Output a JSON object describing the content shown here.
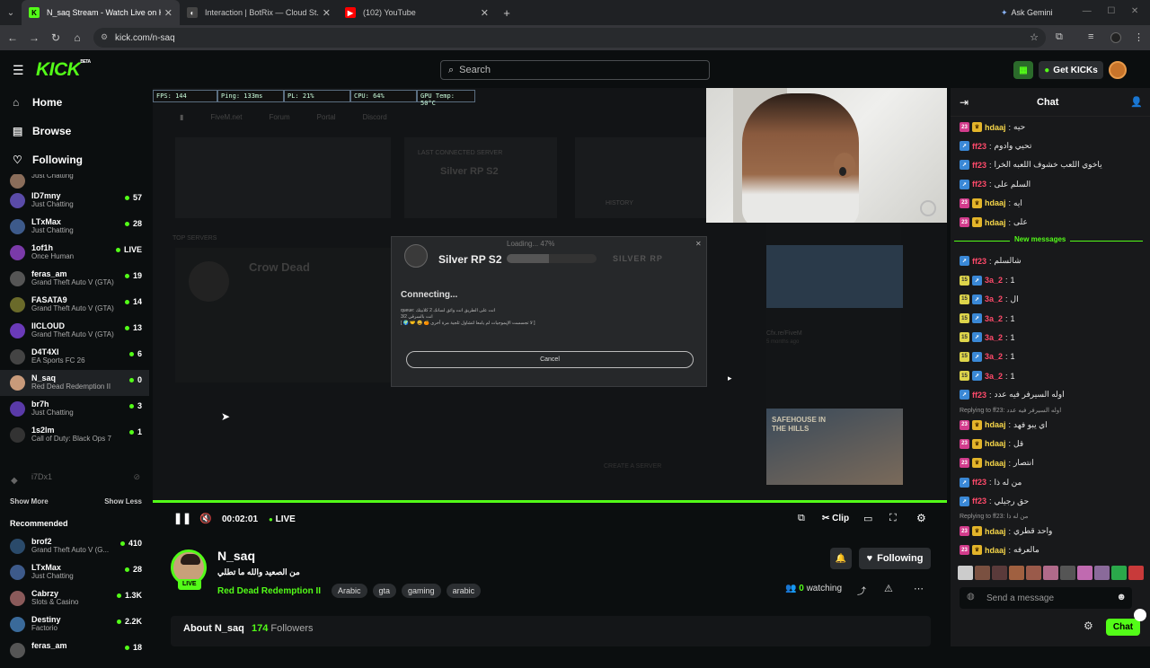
{
  "browser": {
    "tabs": [
      {
        "title": "N_saq Stream - Watch Live on Kick",
        "favicon": "K",
        "favicon_color": "#53fc18"
      },
      {
        "title": "Interaction | BotRix — Cloud St...",
        "favicon": "◐",
        "favicon_color": "#444"
      },
      {
        "title": "(102) YouTube",
        "favicon": "▶",
        "favicon_color": "#ff0000"
      }
    ],
    "new_tab": "+",
    "ask_gemini": "Ask Gemini",
    "url": "kick.com/n-saq"
  },
  "header": {
    "logo": "KICK",
    "logo_sup": "BETA",
    "search_placeholder": "Search",
    "get_kicks": "Get KICKs"
  },
  "sidebar": {
    "nav": [
      {
        "label": "Home",
        "icon": "home-icon"
      },
      {
        "label": "Browse",
        "icon": "browse-icon"
      },
      {
        "label": "Following",
        "icon": "heart-icon"
      }
    ],
    "following": [
      {
        "name": "",
        "category": "Just Chatting",
        "viewers": "",
        "color": "#8a6d5a"
      },
      {
        "name": "ID7mny",
        "category": "Just Chatting",
        "viewers": "57",
        "color": "#5a4ba8"
      },
      {
        "name": "LTxMax",
        "category": "Just Chatting",
        "viewers": "28",
        "color": "#3d5a8a"
      },
      {
        "name": "1of1h",
        "category": "Once Human",
        "viewers": "LIVE",
        "color": "#7a3aa8"
      },
      {
        "name": "feras_am",
        "category": "Grand Theft Auto V (GTA)",
        "viewers": "19",
        "color": "#555"
      },
      {
        "name": "FASATA9",
        "category": "Grand Theft Auto V (GTA)",
        "viewers": "14",
        "color": "#6a6a2a"
      },
      {
        "name": "IICLOUD",
        "category": "Grand Theft Auto V (GTA)",
        "viewers": "13",
        "color": "#6a3ab8"
      },
      {
        "name": "D4T4XI",
        "category": "EA Sports FC 26",
        "viewers": "6",
        "color": "#444"
      },
      {
        "name": "N_saq",
        "category": "Red Dead Redemption II",
        "viewers": "0",
        "color": "#c89a7a"
      },
      {
        "name": "br7h",
        "category": "Just Chatting",
        "viewers": "3",
        "color": "#5a3aa8"
      },
      {
        "name": "1s2lm",
        "category": "Call of Duty: Black Ops 7",
        "viewers": "1",
        "color": "#333"
      }
    ],
    "offline_user": "i7Dx1",
    "show_more": "Show More",
    "show_less": "Show Less",
    "recommended_title": "Recommended",
    "recommended": [
      {
        "name": "brof2",
        "category": "Grand Theft Auto V (G...",
        "viewers": "410",
        "color": "#2a4a6a"
      },
      {
        "name": "LTxMax",
        "category": "Just Chatting",
        "viewers": "28",
        "color": "#3d5a8a"
      },
      {
        "name": "Cabrzy",
        "category": "Slots & Casino",
        "viewers": "1.3K",
        "color": "#8a5a5a"
      },
      {
        "name": "Destiny",
        "category": "Factorio",
        "viewers": "2.2K",
        "color": "#3a6a9a"
      },
      {
        "name": "feras_am",
        "category": "",
        "viewers": "18",
        "color": "#555"
      }
    ]
  },
  "stream_overlay": {
    "stats": [
      "FPS: 144",
      "Ping: 133ms",
      "PL: 21%",
      "CPU: 64%",
      "GPU Temp: 50°C"
    ],
    "fivem_tabs": [
      "FiveM.net",
      "Forum",
      "Portal",
      "Discord"
    ],
    "last_connected": "LAST CONNECTED SERVER",
    "server_name": "Silver RP S2",
    "history": "HISTORY",
    "top_servers": "TOP SERVERS",
    "crow_dead": "Crow Dead",
    "create_server": "CREATE A SERVER",
    "dialog": {
      "server": "Silver RP S2",
      "loading": "Loading... 47%",
      "brand": "SILVER RP",
      "connecting": "Connecting...",
      "queue_label": "queue:",
      "queue_text": "انت على الطريق انت واثق لسانك 2 كلابيتك",
      "queue_count": "3/2",
      "queue_line3": "انت بالسرقي",
      "queue_emoji_line": "[ 🌍 🤝 😀 🍊 لا تجسست الإيموجيات لم يامعا لتشاول ثلجية مرة أخرى ]",
      "cancel": "Cancel"
    },
    "news_title": "Cfx.re/FiveM",
    "news_time": "5 months ago",
    "news_banner": "SAFEHOUSE IN THE HILLS"
  },
  "player": {
    "time": "00:02:01",
    "live": "LIVE",
    "clip": "Clip"
  },
  "channel": {
    "name": "N_saq",
    "title": "من الصعيد والله ما تطلي",
    "live_badge": "LIVE",
    "category": "Red Dead Redemption II",
    "tags": [
      "Arabic",
      "gta",
      "gaming",
      "arabic"
    ],
    "watching_count": "0",
    "watching_label": "watching",
    "following_label": "Following",
    "about": "About N_saq",
    "followers_count": "174",
    "followers_label": "Followers"
  },
  "chat": {
    "title": "Chat",
    "new_messages": "New messages",
    "messages_before": [
      {
        "badges": [
          "23",
          "crown"
        ],
        "user": "hdaaj",
        "color": "#f6d64a",
        "text": "حيه"
      },
      {
        "badges": [
          "arrow"
        ],
        "user": "ff23",
        "color": "#ff4a6a",
        "text": "تحيي وادوم"
      },
      {
        "badges": [
          "arrow"
        ],
        "user": "ff23",
        "color": "#ff4a6a",
        "text": "ياخوي اللعب خشوف اللعبه الخرا"
      },
      {
        "badges": [
          "arrow"
        ],
        "user": "ff23",
        "color": "#ff4a6a",
        "text": "السلم على"
      },
      {
        "badges": [
          "23",
          "crown"
        ],
        "user": "hdaaj",
        "color": "#f6d64a",
        "text": "ايه"
      },
      {
        "badges": [
          "23",
          "crown"
        ],
        "user": "hdaaj",
        "color": "#f6d64a",
        "text": "على"
      }
    ],
    "messages_after": [
      {
        "badges": [
          "arrow"
        ],
        "user": "ff23",
        "color": "#ff4a6a",
        "text": "شالسلم",
        "reply": ""
      },
      {
        "badges": [
          "15",
          "arrow"
        ],
        "user": "3a_2",
        "color": "#ff4a6a",
        "text": "1",
        "reply": ""
      },
      {
        "badges": [
          "15",
          "arrow"
        ],
        "user": "3a_2",
        "color": "#ff4a6a",
        "text": "ال",
        "reply": ""
      },
      {
        "badges": [
          "15",
          "arrow"
        ],
        "user": "3a_2",
        "color": "#ff4a6a",
        "text": "1",
        "reply": ""
      },
      {
        "badges": [
          "15",
          "arrow"
        ],
        "user": "3a_2",
        "color": "#ff4a6a",
        "text": "1",
        "reply": ""
      },
      {
        "badges": [
          "15",
          "arrow"
        ],
        "user": "3a_2",
        "color": "#ff4a6a",
        "text": "1",
        "reply": ""
      },
      {
        "badges": [
          "15",
          "arrow"
        ],
        "user": "3a_2",
        "color": "#ff4a6a",
        "text": "1",
        "reply": ""
      },
      {
        "badges": [
          "arrow"
        ],
        "user": "ff23",
        "color": "#ff4a6a",
        "text": "اوله السيرفر فيه عدد",
        "reply": ""
      },
      {
        "badges": [
          "23",
          "crown"
        ],
        "user": "hdaaj",
        "color": "#f6d64a",
        "text": "اي يبو فهد",
        "reply": "Replying to ff23: اوله السيرفر فيه عدد"
      },
      {
        "badges": [
          "23",
          "crown"
        ],
        "user": "hdaaj",
        "color": "#f6d64a",
        "text": "قل",
        "reply": ""
      },
      {
        "badges": [
          "23",
          "crown"
        ],
        "user": "hdaaj",
        "color": "#f6d64a",
        "text": "انتصار",
        "reply": ""
      },
      {
        "badges": [
          "arrow"
        ],
        "user": "ff23",
        "color": "#ff4a6a",
        "text": "من له ذا",
        "reply": ""
      },
      {
        "badges": [
          "arrow"
        ],
        "user": "ff23",
        "color": "#ff4a6a",
        "text": "حق رجيلي",
        "reply": ""
      },
      {
        "badges": [
          "23",
          "crown"
        ],
        "user": "hdaaj",
        "color": "#f6d64a",
        "text": "واحد قطري",
        "reply": "Replying to ff23: من له ذا"
      },
      {
        "badges": [
          "23",
          "crown"
        ],
        "user": "hdaaj",
        "color": "#f6d64a",
        "text": "مالعرفه",
        "reply": ""
      }
    ],
    "input_placeholder": "Send a message",
    "send_label": "Chat"
  },
  "colors": {
    "accent": "#53fc18"
  }
}
